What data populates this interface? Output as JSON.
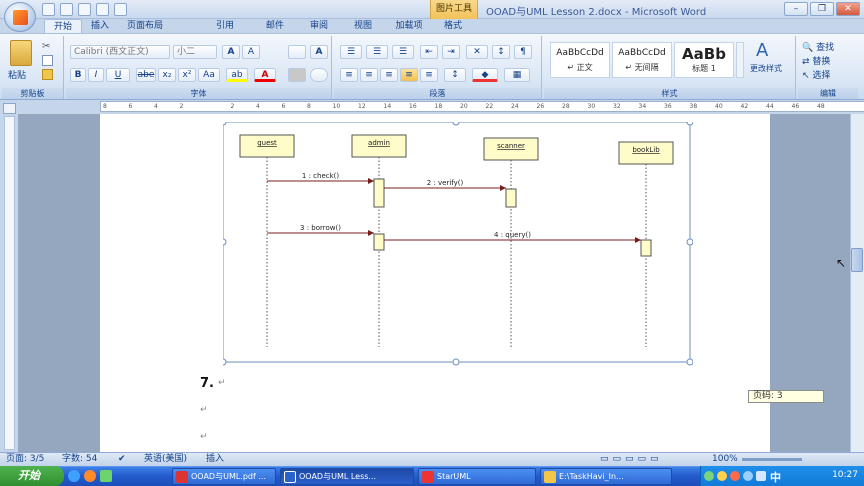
{
  "titlebar": {
    "context_tools": "图片工具",
    "title": "OOAD与UML Lesson 2.docx - Microsoft Word"
  },
  "tabs": [
    "开始",
    "插入",
    "页面布局",
    "引用",
    "邮件",
    "审阅",
    "视图",
    "加载项",
    "格式"
  ],
  "active_tab_index": 0,
  "ribbon": {
    "clipboard": {
      "paste": "粘贴",
      "label": "剪贴板"
    },
    "font": {
      "name": "Calibri (西文正文)",
      "size": "小二",
      "grow": "A",
      "shrink": "A",
      "clear": "A",
      "bold": "B",
      "italic": "I",
      "underline": "U",
      "strike": "abe",
      "sub": "x₂",
      "sup": "x²",
      "case": "Aa",
      "highlight": "ab",
      "color": "A",
      "label": "字体"
    },
    "paragraph": {
      "label": "段落"
    },
    "styles": {
      "items": [
        {
          "sample": "AaBbCcDd",
          "name": "↵ 正文"
        },
        {
          "sample": "AaBbCcDd",
          "name": "↵ 无间隔"
        },
        {
          "sample": "AaBb",
          "name": "标题 1"
        }
      ],
      "change": "更改样式",
      "label": "样式"
    },
    "editing": {
      "find": "查找",
      "replace": "替换",
      "select": "选择",
      "label": "编辑"
    }
  },
  "ruler_ticks": [
    "8",
    "6",
    "4",
    "2",
    "",
    "2",
    "4",
    "6",
    "8",
    "10",
    "12",
    "14",
    "16",
    "18",
    "20",
    "22",
    "24",
    "26",
    "28",
    "30",
    "32",
    "34",
    "36",
    "38",
    "40",
    "42",
    "44",
    "46",
    "48"
  ],
  "diagram": {
    "lifelines": [
      "guest",
      "admin",
      "scanner",
      "bookLib"
    ],
    "messages": [
      "1 : check()",
      "2 : verify()",
      "3 : borrow()",
      "4 : query()"
    ]
  },
  "doc": {
    "heading_num": "7.",
    "para_marks": [
      "↵",
      "↵",
      "↵"
    ]
  },
  "page_tooltip": "页码: 3",
  "statusbar": {
    "page": "页面: 3/5",
    "words": "字数: 54",
    "lang": "英语(美国)",
    "mode": "插入",
    "zoom": "100%"
  },
  "taskbar": {
    "start": "开始",
    "items": [
      "OOAD与UML.pdf ...",
      "OOAD与UML Less...",
      "StarUML",
      "E:\\TaskHavi_In..."
    ],
    "ime": "中",
    "clock": "10:27"
  }
}
